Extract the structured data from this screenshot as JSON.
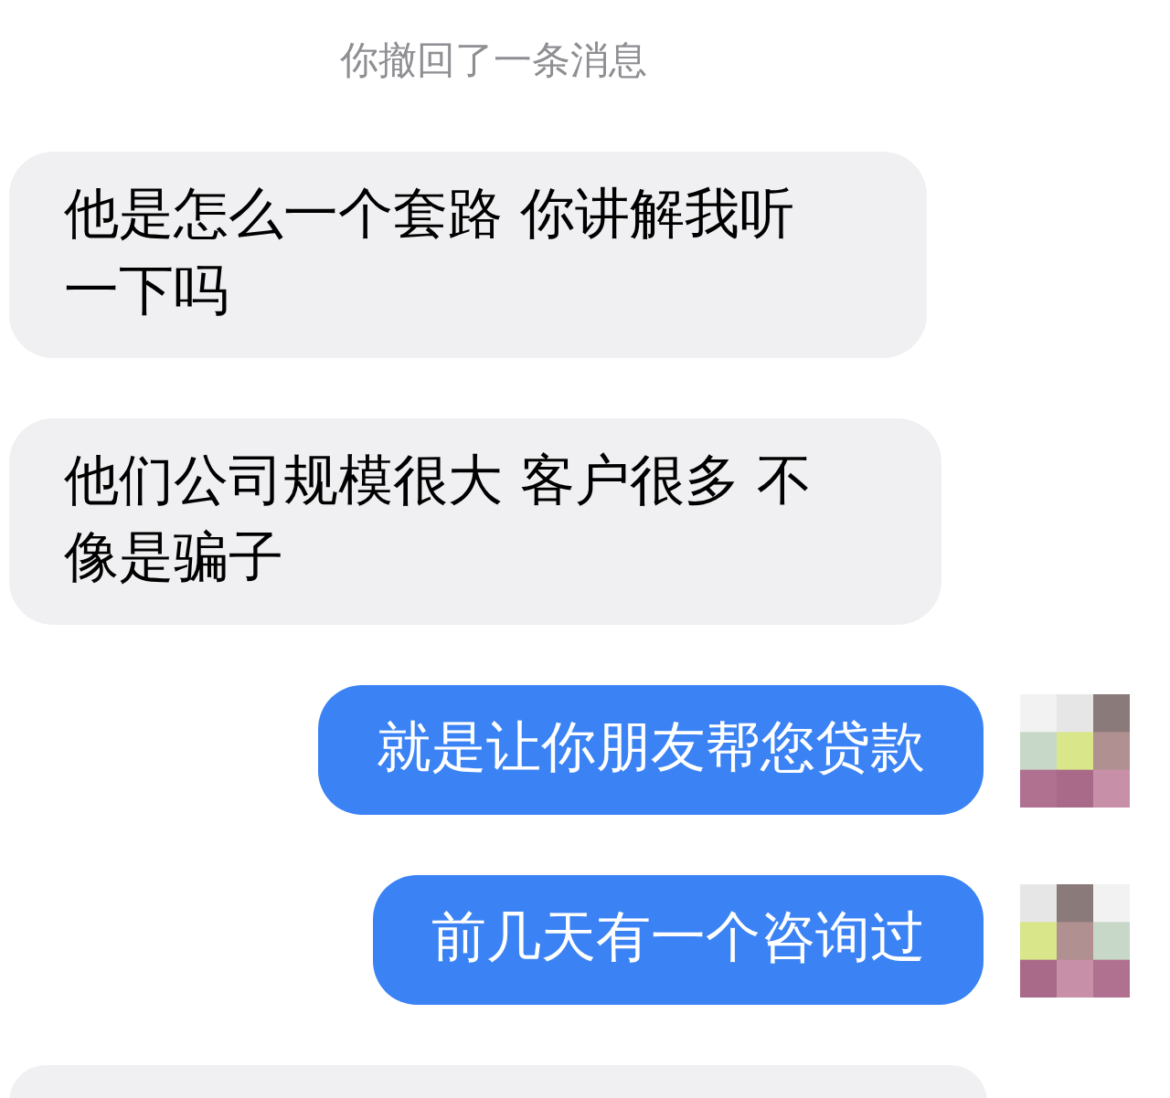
{
  "system_notice": "你撤回了一条消息",
  "messages": [
    {
      "outgoing": false,
      "text": "他是怎么一个套路 你讲解我听一下吗"
    },
    {
      "outgoing": false,
      "text": "他们公司规模很大 客户很多 不像是骗子"
    },
    {
      "outgoing": true,
      "text": "就是让你朋友帮您贷款"
    },
    {
      "outgoing": true,
      "text": "前几天有一个咨询过"
    },
    {
      "outgoing": false
    }
  ]
}
